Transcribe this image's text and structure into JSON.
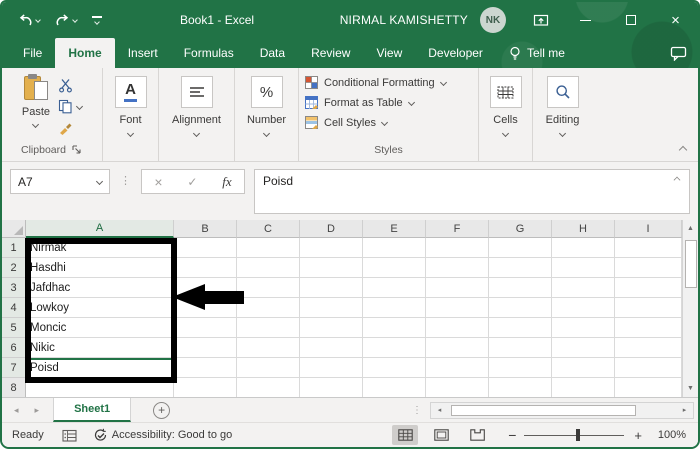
{
  "window": {
    "title": "Book1 - Excel"
  },
  "titlebar": {
    "user_name": "NIRMAL KAMISHETTY",
    "user_initials": "NK"
  },
  "tabs": {
    "file": "File",
    "home": "Home",
    "insert": "Insert",
    "formulas": "Formulas",
    "data": "Data",
    "review": "Review",
    "view": "View",
    "developer": "Developer",
    "tell_me": "Tell me"
  },
  "ribbon": {
    "paste": "Paste",
    "clipboard": "Clipboard",
    "font": "Font",
    "alignment": "Alignment",
    "number": "Number",
    "conditional_formatting": "Conditional Formatting",
    "format_as_table": "Format as Table",
    "cell_styles": "Cell Styles",
    "styles": "Styles",
    "cells": "Cells",
    "editing": "Editing"
  },
  "formula": {
    "name_box": "A7",
    "fx": "fx",
    "value": "Poisd"
  },
  "sheet": {
    "columns": [
      "A",
      "B",
      "C",
      "D",
      "E",
      "F",
      "G",
      "H",
      "I"
    ],
    "row_numbers": [
      "1",
      "2",
      "3",
      "4",
      "5",
      "6",
      "7",
      "8"
    ],
    "cells": {
      "A": [
        "Nirmak",
        "Hasdhi",
        "Jafdhac",
        "Lowkoy",
        "Moncic",
        "Nikic",
        "Poisd",
        ""
      ]
    },
    "active_cell": "A7"
  },
  "sheetbar": {
    "sheet1": "Sheet1"
  },
  "statusbar": {
    "ready": "Ready",
    "accessibility": "Accessibility: Good to go",
    "zoom_level": "100%"
  },
  "colors": {
    "excel_green": "#217346",
    "annotation": "#000000",
    "ribbon_bg": "#f3f2f1"
  }
}
